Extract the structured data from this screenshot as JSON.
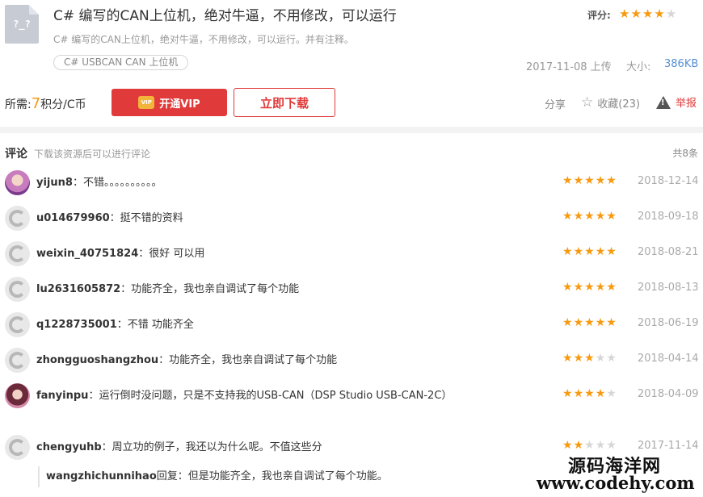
{
  "resource": {
    "icon_text": "?_?",
    "title": "C# 编写的CAN上位机，绝对牛逼，不用修改，可以运行",
    "description": "C# 编写的CAN上位机，绝对牛逼，不用修改，可以运行。并有注释。",
    "tag": "C# USBCAN CAN 上位机",
    "rating_label": "评分:",
    "rating": 4,
    "upload_date": "2017-11-08 上传",
    "size_label": "大小:",
    "size_value": "386KB"
  },
  "price": {
    "prefix": "所需:",
    "amount": "7",
    "suffix": "积分/C币"
  },
  "actions": {
    "vip_label": "开通VIP",
    "vip_badge": "VIP",
    "download_label": "立即下载",
    "share_label": "分享",
    "favorite_label": "收藏(23)",
    "report_label": "举报"
  },
  "comments_section": {
    "title": "评论",
    "hint": "下载该资源后可以进行评论",
    "count": "共8条"
  },
  "comments": [
    {
      "user": "yijun8",
      "text": "：不错。。。。。。。。。。",
      "stars": 5,
      "date": "2018-12-14",
      "avatar": "photo1"
    },
    {
      "user": "u014679960",
      "text": "：挺不错的资料",
      "stars": 5,
      "date": "2018-09-18",
      "avatar": "default"
    },
    {
      "user": "weixin_40751824",
      "text": "：很好 可以用",
      "stars": 5,
      "date": "2018-08-21",
      "avatar": "default"
    },
    {
      "user": "lu2631605872",
      "text": "：功能齐全，我也亲自调试了每个功能",
      "stars": 5,
      "date": "2018-08-13",
      "avatar": "default"
    },
    {
      "user": "q1228735001",
      "text": "：不错 功能齐全",
      "stars": 5,
      "date": "2018-06-19",
      "avatar": "default"
    },
    {
      "user": "zhongguoshangzhou",
      "text": "：功能齐全，我也亲自调试了每个功能",
      "stars": 3,
      "date": "2018-04-14",
      "avatar": "default"
    },
    {
      "user": "fanyinpu",
      "text": "：运行倒时没问题，只是不支持我的USB-CAN（DSP Studio USB-CAN-2C）",
      "stars": 4,
      "date": "2018-04-09",
      "avatar": "photo2"
    },
    {
      "user": "chengyuhb",
      "text": "：周立功的例子，我还以为什么呢。不值这些分",
      "stars": 2,
      "date": "2017-11-14",
      "avatar": "default"
    }
  ],
  "reply": {
    "user": "wangzhichunnihao",
    "text": "回复：但是功能齐全，我也亲自调试了每个功能。"
  },
  "watermark": {
    "line1": "源码海洋网",
    "line2": "www.codehy.com"
  },
  "colors": {
    "accent_red": "#e03a3a",
    "star_orange": "#f79a10",
    "link_blue": "#5690d4"
  }
}
